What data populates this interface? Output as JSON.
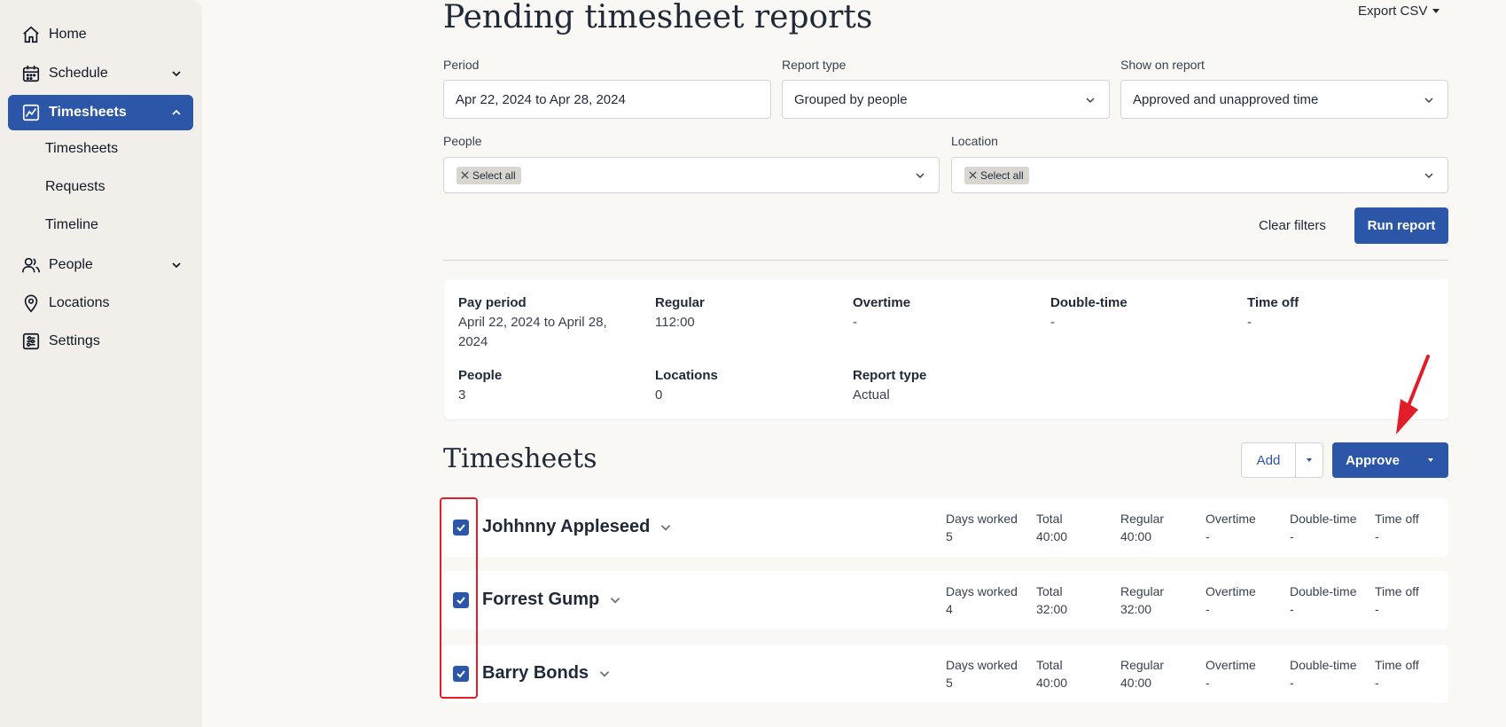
{
  "sidebar": {
    "items": [
      {
        "label": "Home",
        "icon": "home-icon"
      },
      {
        "label": "Schedule",
        "icon": "calendar-icon"
      },
      {
        "label": "Timesheets",
        "icon": "timesheet-chart-icon"
      },
      {
        "label": "People",
        "icon": "people-icon"
      },
      {
        "label": "Locations",
        "icon": "location-pin-icon"
      },
      {
        "label": "Settings",
        "icon": "sliders-icon"
      }
    ],
    "sub_items": [
      "Timesheets",
      "Requests",
      "Timeline"
    ]
  },
  "header": {
    "title": "Pending timesheet reports",
    "export_label": "Export CSV"
  },
  "filters": {
    "period": {
      "label": "Period",
      "value": "Apr 22, 2024 to Apr 28, 2024"
    },
    "report_type": {
      "label": "Report type",
      "value": "Grouped by people"
    },
    "show_on_report": {
      "label": "Show on report",
      "value": "Approved and unapproved time"
    },
    "people": {
      "label": "People",
      "chip": "Select all"
    },
    "location": {
      "label": "Location",
      "chip": "Select all"
    },
    "clear_label": "Clear filters",
    "run_label": "Run report"
  },
  "summary": {
    "pay_period": {
      "label": "Pay period",
      "value_line1": "April 22, 2024 to April 28,",
      "value_line2": "2024"
    },
    "regular": {
      "label": "Regular",
      "value": "112:00"
    },
    "overtime": {
      "label": "Overtime",
      "value": "-"
    },
    "double_time": {
      "label": "Double-time",
      "value": "-"
    },
    "time_off": {
      "label": "Time off",
      "value": "-"
    },
    "people": {
      "label": "People",
      "value": "3"
    },
    "locations": {
      "label": "Locations",
      "value": "0"
    },
    "report_type": {
      "label": "Report type",
      "value": "Actual"
    }
  },
  "timesheets": {
    "title": "Timesheets",
    "add_label": "Add",
    "approve_label": "Approve",
    "columns": [
      "Days worked",
      "Total",
      "Regular",
      "Overtime",
      "Double-time",
      "Time off"
    ],
    "rows": [
      {
        "name": "Johhnny Appleseed",
        "checked": true,
        "values": [
          "5",
          "40:00",
          "40:00",
          "-",
          "-",
          "-"
        ]
      },
      {
        "name": "Forrest Gump",
        "checked": true,
        "values": [
          "4",
          "32:00",
          "32:00",
          "-",
          "-",
          "-"
        ]
      },
      {
        "name": "Barry Bonds",
        "checked": true,
        "values": [
          "5",
          "40:00",
          "40:00",
          "-",
          "-",
          "-"
        ]
      }
    ]
  },
  "colors": {
    "accent": "#2c56a7",
    "annotation": "#e11d2a",
    "sidebar_bg": "#f2efea",
    "page_bg": "#faf8f5"
  }
}
